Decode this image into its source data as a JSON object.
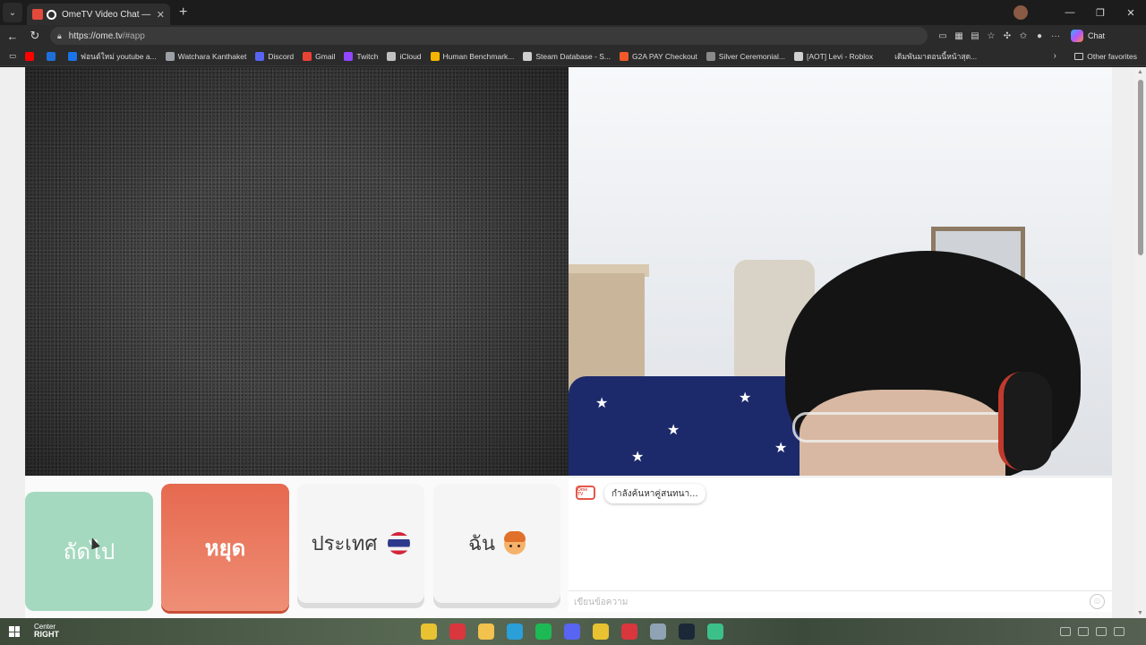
{
  "browser": {
    "tab_title": "OmeTV Video Chat — Omegle",
    "tab_close": "✕",
    "new_tab": "+",
    "url_host": "https://ome.tv",
    "url_path": "/#app",
    "copilot_label": "Chat",
    "more": "···"
  },
  "bookmarks": [
    {
      "label": "",
      "color": "#ff0000"
    },
    {
      "label": "",
      "color": "#1e6fd9"
    },
    {
      "label": "ฟอนต์ใหม่ youtube a...",
      "color": "#1a73e8"
    },
    {
      "label": "Watchara Kanthaket",
      "color": "#9aa0a6"
    },
    {
      "label": "Discord",
      "color": "#5865f2"
    },
    {
      "label": "Gmail",
      "color": "#ea4335"
    },
    {
      "label": "Twitch",
      "color": "#9146ff"
    },
    {
      "label": "iCloud",
      "color": "#c0c0c0"
    },
    {
      "label": "Human Benchmark...",
      "color": "#f4b400"
    },
    {
      "label": "Steam Database - S...",
      "color": "#cfcfcf"
    },
    {
      "label": "G2A PAY Checkout",
      "color": "#f05a28"
    },
    {
      "label": "Silver Ceremonial...",
      "color": "#8a8a8a"
    },
    {
      "label": "[AOT] Levi - Roblox",
      "color": "#d0d0d0"
    },
    {
      "label": "เดิมพันมาตอนนี้หน้าสุด...",
      "color": "#2b2b2b"
    }
  ],
  "bookmarks_other": "Other favorites",
  "controls": {
    "next_label": "ถัดไป",
    "stop_label": "หยุด",
    "country_label": "ประเทศ",
    "me_label": "ฉัน"
  },
  "chat": {
    "logo_text": "Ome TV",
    "status_message": "กำลังค้นหาคู่สนทนา...",
    "input_placeholder": "เขียนข้อความ",
    "emoji_glyph": "☺"
  },
  "taskbar": {
    "weather_line1": "Center",
    "weather_line2": "RIGHT"
  },
  "colors": {
    "next_button": "#a5d9bf",
    "stop_button": "#e6694f",
    "brand_red": "#e4574a"
  }
}
